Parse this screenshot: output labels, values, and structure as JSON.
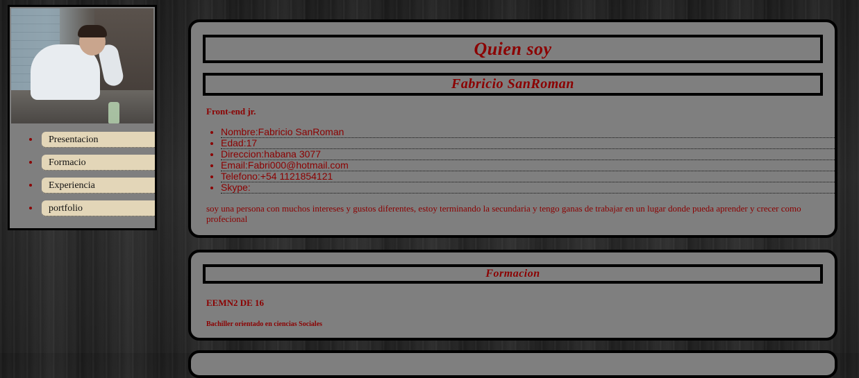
{
  "sidebar": {
    "menu": [
      {
        "label": "Presentacion"
      },
      {
        "label": "Formacio"
      },
      {
        "label": "Experiencia"
      },
      {
        "label": "portfolio"
      }
    ]
  },
  "about": {
    "title": "Quien soy",
    "name": "Fabricio SanRoman",
    "role": "Front-end jr.",
    "details": [
      "Nombre:Fabricio SanRoman",
      "Edad:17",
      "Direccion:habana 3077",
      "Email:Fabri000@hotmail.com",
      "Telefono:+54 1121854121",
      "Skype:"
    ],
    "description": "soy una persona con muchos intereses y gustos diferentes, estoy terminando la secundaria y tengo ganas de trabajar en un lugar donde pueda aprender y crecer como profecional"
  },
  "formacion": {
    "title": "Formacion",
    "school": "EEMN2 DE 16",
    "degree": "Bachiller orientado en ciencias Sociales"
  },
  "colors": {
    "accent": "#8b0000",
    "panel": "#7f7f7f",
    "menu_button": "#e3d6b8",
    "border": "#000000"
  }
}
